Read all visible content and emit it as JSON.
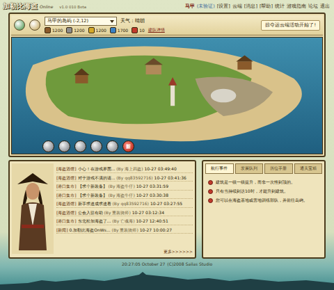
{
  "header": {
    "logo": "加勒比海盗",
    "logo_sub": "Online",
    "version": "v1.0 010 Beta",
    "user": "马甲",
    "user_status": "(未验证)",
    "links": [
      "[设置]",
      "云端",
      "[消息]",
      "[帮助]",
      "统计",
      "游戏指南",
      "论坛",
      "退出"
    ]
  },
  "toolbar": {
    "island_select": "马甲的岛屿 (-2,12)",
    "weather": "天气：晴朗",
    "notice": "掠夺运云端活动开始了!",
    "detail_link": "建队详情",
    "resources": [
      {
        "value": "1200",
        "color": "#8a5a2b"
      },
      {
        "value": "1200",
        "color": "#8c8c8c"
      },
      {
        "value": "1200",
        "color": "#d4a92a"
      },
      {
        "value": "1700",
        "color": "#3a7fc0"
      },
      {
        "value": "10",
        "color": "#c0392b"
      }
    ]
  },
  "map_buttons": [
    {
      "label": "",
      "highlight": false
    },
    {
      "label": "",
      "highlight": false
    },
    {
      "label": "",
      "highlight": false
    },
    {
      "label": "",
      "highlight": false
    },
    {
      "label": "",
      "highlight": false
    },
    {
      "label": "新",
      "highlight": true
    }
  ],
  "messages": [
    {
      "channel": "[海盗酒馆]",
      "text": "小心！在游戏界面...",
      "author": "(By 海上四盗)",
      "time": "10-27 03:49:40"
    },
    {
      "channel": "[海盗酒馆]",
      "text": "对于游戏不满的请...",
      "author": "(By qq83592716)",
      "time": "10-27 03:41:36"
    },
    {
      "channel": "[港口集市]",
      "text": "【求个新装备】",
      "author": "(By 海盗牛仔)",
      "time": "10-27 03:31:59"
    },
    {
      "channel": "[港口集市]",
      "text": "【求个新装备】",
      "author": "(By 海盗牛仔)",
      "time": "10-27 03:30:38"
    },
    {
      "channel": "[海盗酒馆]",
      "text": "新手求速成求速看",
      "author": "(By qq83592716)",
      "time": "10-27 03:27:55"
    },
    {
      "channel": "[海盗酒馆]",
      "text": "公会入驻有助",
      "author": "(By 重装骑师)",
      "time": "10-27 03:12:34"
    },
    {
      "channel": "[港口集市]",
      "text": "东北松加海盗了...",
      "author": "(By 亡魂海)",
      "time": "10-27 12:40:51"
    },
    {
      "channel": "[新闻]",
      "text": "0.加勒比海盗OnWs...",
      "author": "(By 重装骑师)",
      "time": "10-27 10:00:27"
    }
  ],
  "more": "更多>>>>>>",
  "tabs": [
    {
      "label": "航行事件",
      "selected": true
    },
    {
      "label": "发展队列",
      "selected": false
    },
    {
      "label": "历位手册",
      "selected": false
    },
    {
      "label": "通关宝箱",
      "selected": false
    }
  ],
  "tips": [
    "建筑是一级一级提升，而非一次性到顶的。",
    "只有当持续到达10时，才能升到建筑。",
    "您可以在海盗基地或营地训练部队，并前往岛屿。"
  ],
  "footer": {
    "time": "20:27:05 October 27",
    "copyright": "(C)2008 Sailas Studio"
  }
}
